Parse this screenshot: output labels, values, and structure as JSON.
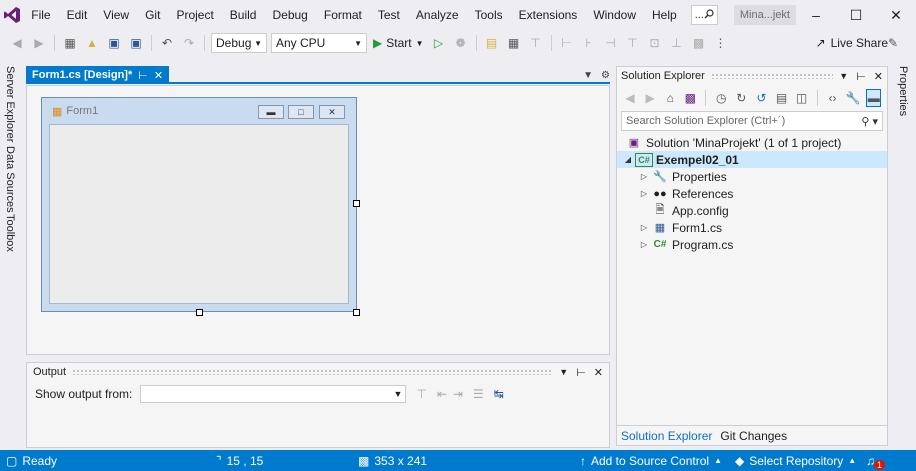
{
  "menu": {
    "items": [
      "File",
      "Edit",
      "View",
      "Git",
      "Project",
      "Build",
      "Debug",
      "Format",
      "Test",
      "Analyze",
      "Tools",
      "Extensions",
      "Window",
      "Help"
    ],
    "search_text": "...",
    "solution_title": "Mina...jekt"
  },
  "toolbar": {
    "configuration": "Debug",
    "platform": "Any CPU",
    "start_label": "Start",
    "live_share_label": "Live Share"
  },
  "left_tabs": [
    "Server Explorer",
    "Data Sources",
    "Toolbox"
  ],
  "document": {
    "tab_title": "Form1.cs [Design]*",
    "form_title": "Form1"
  },
  "output": {
    "title": "Output",
    "show_from_label": "Show output from:",
    "show_from_value": ""
  },
  "solution_explorer": {
    "title": "Solution Explorer",
    "search_placeholder": "Search Solution Explorer (Ctrl+´)",
    "solution_node": "Solution 'MinaProjekt' (1 of 1 project)",
    "project_node": "Exempel02_01",
    "children": [
      "Properties",
      "References",
      "App.config",
      "Form1.cs",
      "Program.cs"
    ],
    "tabs": [
      "Solution Explorer",
      "Git Changes"
    ]
  },
  "right_tab": "Properties",
  "status": {
    "ready": "Ready",
    "position": "15 , 15",
    "size": "353 x 241",
    "add_to_source_control": "Add to Source Control",
    "select_repository": "Select Repository",
    "notification_count": "1"
  },
  "colors": {
    "accent": "#007acc",
    "vs_purple": "#68217a",
    "play_green": "#1e9e3a",
    "csharp_green": "#388a34",
    "selection": "#cce8ff",
    "notification_red": "#e51400"
  }
}
